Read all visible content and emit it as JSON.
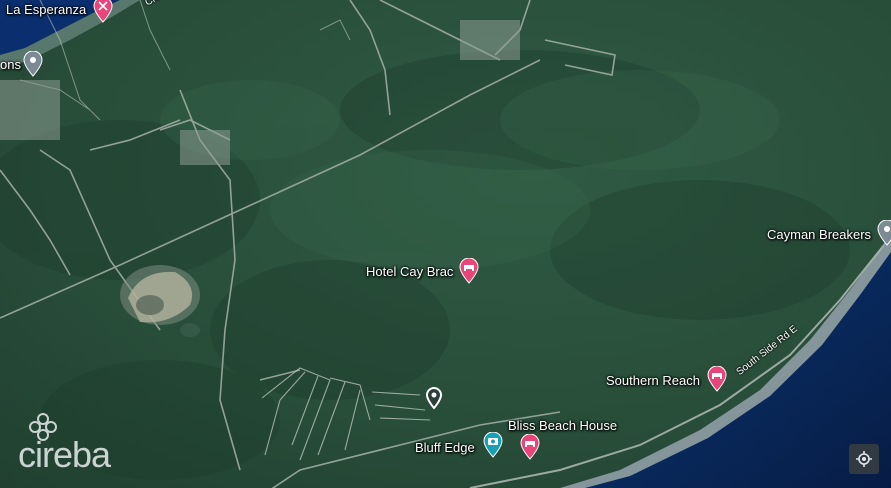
{
  "places": {
    "la_esperanza": "La Esperanza",
    "ons_partial": "ons",
    "hotel_cay_brac": "Hotel Cay Brac",
    "cayman_breakers": "Cayman Breakers",
    "southern_reach": "Southern Reach",
    "bliss_beach_house": "Bliss Beach House",
    "bluff_edge": "Bluff Edge"
  },
  "roads": {
    "south_side_rd_e": "South Side Rd E",
    "cre_partial": "Cre"
  },
  "logo": {
    "text": "cireba"
  },
  "colors": {
    "pin_pink": "#e8457a",
    "pin_teal": "#1a9fb5",
    "pin_gray": "#7c8a93",
    "pin_white": "#ffffff",
    "sea_deep": "#0b2a5c",
    "forest": "#2e5540"
  },
  "icons": {
    "la_esperanza": "restaurant-pin-icon",
    "ons": "place-pin-icon",
    "hotel_cay_brac": "hotel-pin-icon",
    "cayman_breakers": "place-pin-icon",
    "southern_reach": "hotel-pin-icon",
    "bliss_beach_house": "hotel-pin-icon",
    "bluff_edge": "camera-pin-icon",
    "property": "place-pin-icon",
    "locate": "my-location-icon"
  }
}
